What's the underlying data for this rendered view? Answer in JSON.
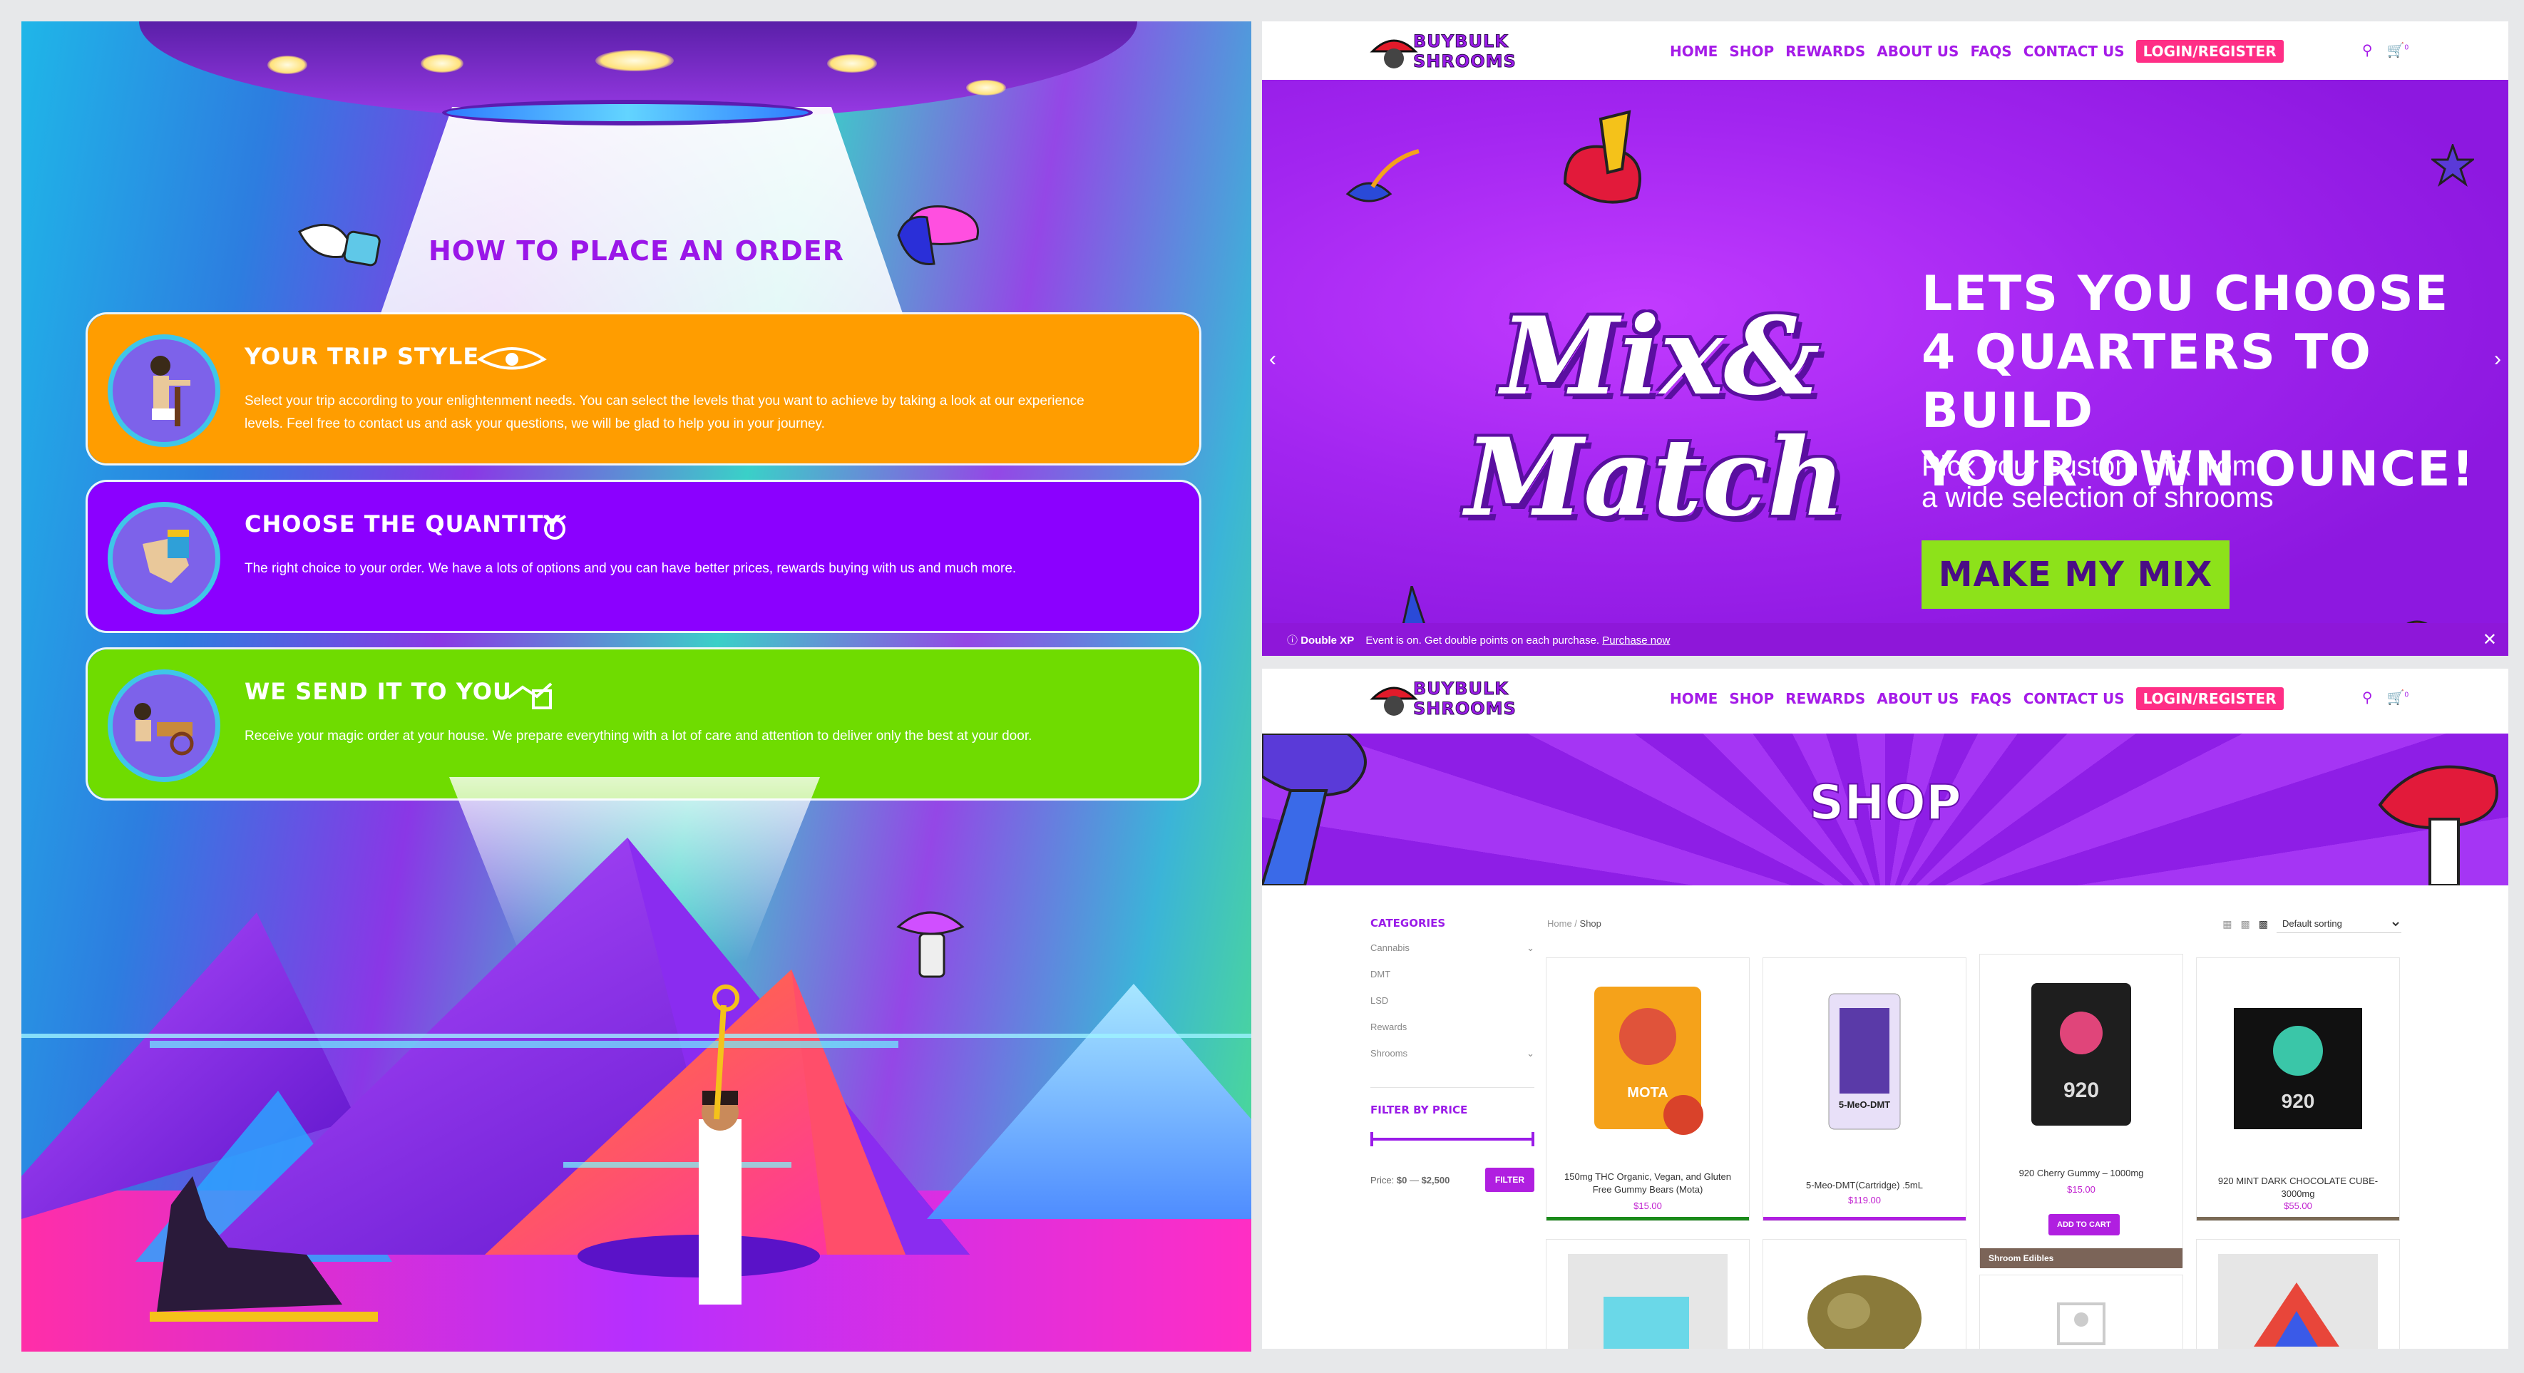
{
  "order_page": {
    "heading": "HOW TO PLACE AN ORDER",
    "steps": [
      {
        "title": "YOUR TRIP STYLE",
        "description": "Select your trip according to your enlightenment needs. You can select the levels that you want to achieve by taking a look at our experience levels. Feel free to contact us and ask your questions, we will be glad to help you in your journey.",
        "color": "#ff9d00"
      },
      {
        "title": "CHOOSE THE QUANTITY",
        "description": "The right choice to your order. We have a lots of options and you can have better prices, rewards buying with us and much more.",
        "color": "#8b00ff"
      },
      {
        "title": "WE SEND IT TO YOU",
        "description": "Receive your magic order at your house. We prepare everything with a lot of care and attention to deliver only the best at your door.",
        "color": "#6fdc00"
      }
    ]
  },
  "site": {
    "logo_line1": "BUYBULK",
    "logo_line2": "SHROOMS",
    "nav": [
      "HOME",
      "SHOP",
      "REWARDS",
      "ABOUT US",
      "FAQS",
      "CONTACT US"
    ],
    "login_label": "LOGIN/REGISTER",
    "cart_count": "0",
    "brand_color": "#a51be8",
    "accent_pink": "#ff2e86"
  },
  "hero": {
    "logo_word1": "Mix&",
    "logo_word2": "Match",
    "headline": [
      "LETS YOU CHOOSE",
      "4 QUARTERS TO BUILD",
      "YOUR OWN OUNCE!"
    ],
    "subtext": [
      "Pick your custom mix from",
      "a wide selection of shrooms"
    ],
    "cta": "MAKE MY MIX",
    "notice_bold": "Double XP",
    "notice_text": "Event is on. Get double points on each purchase.",
    "notice_link": "Purchase now"
  },
  "shop": {
    "title": "SHOP",
    "categories_heading": "CATEGORIES",
    "categories": [
      {
        "name": "Cannabis",
        "expandable": true
      },
      {
        "name": "DMT",
        "expandable": false
      },
      {
        "name": "LSD",
        "expandable": false
      },
      {
        "name": "Rewards",
        "expandable": false
      },
      {
        "name": "Shrooms",
        "expandable": true
      }
    ],
    "filter_heading": "FILTER BY PRICE",
    "price_label": "Price:",
    "price_min": "$0",
    "price_max": "$2,500",
    "filter_button": "FILTER",
    "breadcrumb_home": "Home",
    "breadcrumb_current": "Shop",
    "sorting": "Default sorting",
    "products": [
      {
        "name": "150mg THC Organic, Vegan, and Gluten Free Gummy Bears (Mota)",
        "price": "$15.00",
        "bar_color": "#1a8a1a",
        "label": "MOTA"
      },
      {
        "name": "5-Meo-DMT(Cartridge) .5mL",
        "price": "$119.00",
        "bar_color": "#b01fe0",
        "label": "5-MeO-DMT"
      },
      {
        "name": "920 Cherry Gummy – 1000mg",
        "price": "$15.00",
        "bar_color": "#ffffff",
        "label": "920",
        "button": "ADD TO CART"
      },
      {
        "name": "920 MINT DARK CHOCOLATE CUBE-3000mg",
        "price": "$55.00",
        "bar_color": "#7a6a55",
        "label": "920"
      }
    ],
    "second_row_tag": "Shroom Edibles"
  }
}
